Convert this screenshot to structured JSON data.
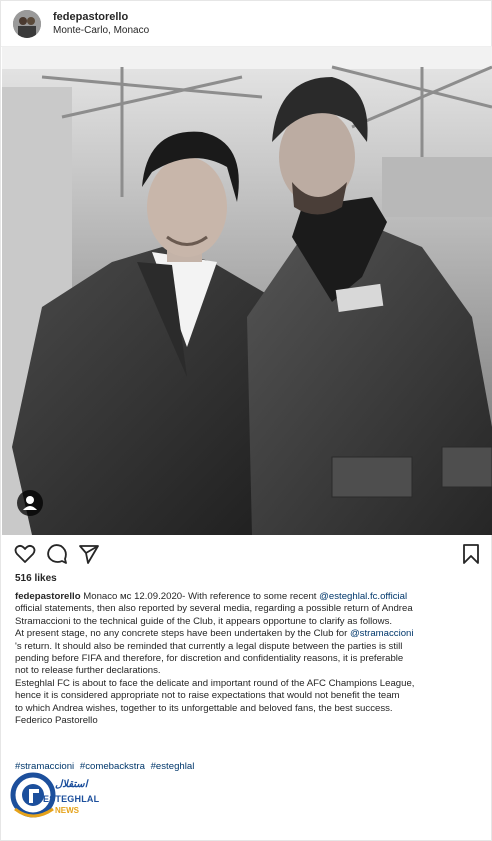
{
  "header": {
    "username": "fedepastorello",
    "location": "Monte-Carlo, Monaco"
  },
  "post": {
    "likes": "516 likes",
    "caption": {
      "username": "fedepastorello",
      "lines": [
        {
          "before": " Monaco мс 12.09.2020- With reference to some recent ",
          "mention": "@esteghlal.fc.official",
          "after": ""
        },
        {
          "before": "official statements, then also reported by several media, regarding a possible return of Andrea",
          "mention": "",
          "after": ""
        },
        {
          "before": "Stramaccioni to the technical guide of the Club, it appears opportune to clarify as follows.",
          "mention": "",
          "after": ""
        },
        {
          "before": "At present stage, no any concrete steps have been undertaken by the Club for ",
          "mention": "@stramaccioni",
          "after": ""
        },
        {
          "before": "'s return. It should also be reminded that currently a legal dispute between the parties is still",
          "mention": "",
          "after": ""
        },
        {
          "before": "pending before FIFA and therefore, for discretion and confidentiality reasons, it is preferable",
          "mention": "",
          "after": ""
        },
        {
          "before": "not to release further declarations.",
          "mention": "",
          "after": ""
        },
        {
          "before": "Esteghlal FC is about to face the delicate and important round of the AFC Champions League,",
          "mention": "",
          "after": ""
        },
        {
          "before": "hence it is considered appropriate not to raise expectations that would not benefit the team",
          "mention": "",
          "after": ""
        },
        {
          "before": "to which Andrea wishes, together to its unforgettable and beloved fans, the best success.",
          "mention": "",
          "after": ""
        },
        {
          "before": "Federico Pastorello",
          "mention": "",
          "after": ""
        }
      ]
    },
    "hashtags": [
      "#stramaccioni",
      "#comebackstra",
      "#esteghlal"
    ]
  },
  "watermark": {
    "brand": "ESTEGHLAL",
    "news": "NEWS",
    "persian": "استقلال"
  },
  "icons": {
    "like": "heart-icon",
    "comment": "comment-icon",
    "share": "paper-plane-icon",
    "save": "bookmark-icon",
    "tag": "user-tag-icon"
  },
  "colors": {
    "mention": "#00376b",
    "text": "#262626",
    "logo_blue": "#1c4f9c",
    "logo_gold": "#e5a21a"
  }
}
